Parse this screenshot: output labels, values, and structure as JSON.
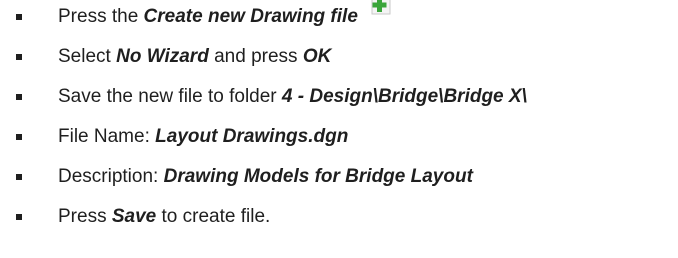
{
  "steps": [
    {
      "parts": [
        {
          "text": "Press the ",
          "emphasis": false
        },
        {
          "text": "Create new Drawing file",
          "emphasis": true
        }
      ],
      "icon": "create-new-file-icon"
    },
    {
      "parts": [
        {
          "text": "Select ",
          "emphasis": false
        },
        {
          "text": "No Wizard",
          "emphasis": true
        },
        {
          "text": " and press ",
          "emphasis": false
        },
        {
          "text": "OK",
          "emphasis": true
        }
      ]
    },
    {
      "parts": [
        {
          "text": "Save the new file to folder ",
          "emphasis": false
        },
        {
          "text": "4 - Design\\Bridge\\Bridge X\\",
          "emphasis": true
        }
      ]
    },
    {
      "parts": [
        {
          "text": "File Name: ",
          "emphasis": false
        },
        {
          "text": "Layout Drawings.dgn",
          "emphasis": true
        }
      ]
    },
    {
      "parts": [
        {
          "text": "Description: ",
          "emphasis": false
        },
        {
          "text": "Drawing Models for Bridge Layout",
          "emphasis": true
        }
      ]
    },
    {
      "parts": [
        {
          "text": "Press ",
          "emphasis": false
        },
        {
          "text": "Save",
          "emphasis": true
        },
        {
          "text": " to create file.",
          "emphasis": false
        }
      ]
    }
  ],
  "colors": {
    "text": "#1f1f1f",
    "icon_green": "#3aa53a",
    "icon_page": "#f4f4f4"
  }
}
